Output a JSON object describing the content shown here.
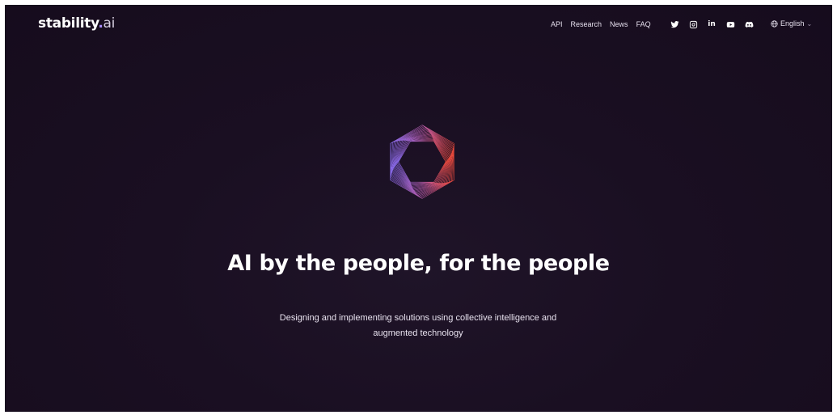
{
  "header": {
    "logo_main": "stability",
    "logo_dot": ".",
    "logo_suffix": "ai",
    "nav": [
      {
        "label": "API"
      },
      {
        "label": "Research"
      },
      {
        "label": "News"
      },
      {
        "label": "FAQ"
      }
    ],
    "social_icons": [
      "twitter-icon",
      "instagram-icon",
      "linkedin-icon",
      "youtube-icon",
      "discord-icon"
    ],
    "linkedin_text": "in",
    "language": "English",
    "language_chevron": "⌄"
  },
  "hero": {
    "title": "AI by the people, for the people",
    "subtitle": "Designing and implementing solutions using collective intelligence and augmented technology"
  },
  "colors": {
    "background": "#1a0f22",
    "hex_gradient_start": "#8b6cf0",
    "hex_gradient_end": "#f04a3a"
  }
}
